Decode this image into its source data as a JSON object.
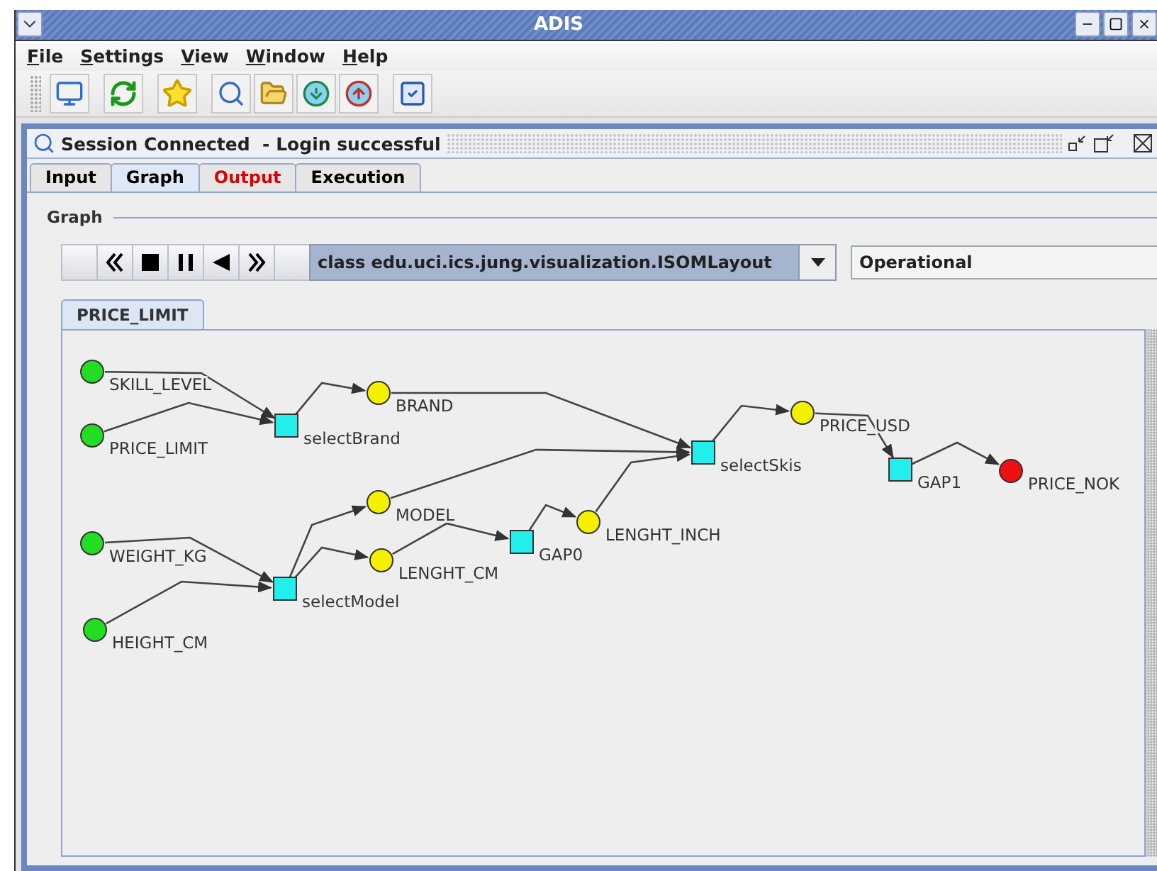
{
  "window": {
    "title": "ADIS"
  },
  "menu": [
    {
      "label": "File"
    },
    {
      "label": "Settings"
    },
    {
      "label": "View"
    },
    {
      "label": "Window"
    },
    {
      "label": "Help"
    }
  ],
  "frame": {
    "title": "Session Connected  - Login successful"
  },
  "tabs": [
    {
      "label": "Input",
      "selected": false,
      "color": "#000000"
    },
    {
      "label": "Graph",
      "selected": true,
      "color": "#000000"
    },
    {
      "label": "Output",
      "selected": false,
      "color": "#dd0000"
    },
    {
      "label": "Execution",
      "selected": false,
      "color": "#000000"
    }
  ],
  "graph_panel": {
    "title": "Graph",
    "layout": "class edu.uci.ics.jung.visualization.ISOMLayout",
    "status": "Operational",
    "graph_tabs": [
      {
        "label": "PRICE_LIMIT",
        "selected": true
      }
    ],
    "nodes": [
      {
        "label": "SKILL_LEVEL",
        "kind": "input"
      },
      {
        "label": "PRICE_LIMIT",
        "kind": "input"
      },
      {
        "label": "selectBrand",
        "kind": "function"
      },
      {
        "label": "BRAND",
        "kind": "variable"
      },
      {
        "label": "WEIGHT_KG",
        "kind": "input"
      },
      {
        "label": "HEIGHT_CM",
        "kind": "input"
      },
      {
        "label": "selectModel",
        "kind": "function"
      },
      {
        "label": "MODEL",
        "kind": "variable"
      },
      {
        "label": "LENGHT_CM",
        "kind": "variable"
      },
      {
        "label": "GAP0",
        "kind": "function"
      },
      {
        "label": "LENGHT_INCH",
        "kind": "variable"
      },
      {
        "label": "selectSkis",
        "kind": "function"
      },
      {
        "label": "PRICE_USD",
        "kind": "variable"
      },
      {
        "label": "GAP1",
        "kind": "function"
      },
      {
        "label": "PRICE_NOK",
        "kind": "output"
      }
    ]
  }
}
